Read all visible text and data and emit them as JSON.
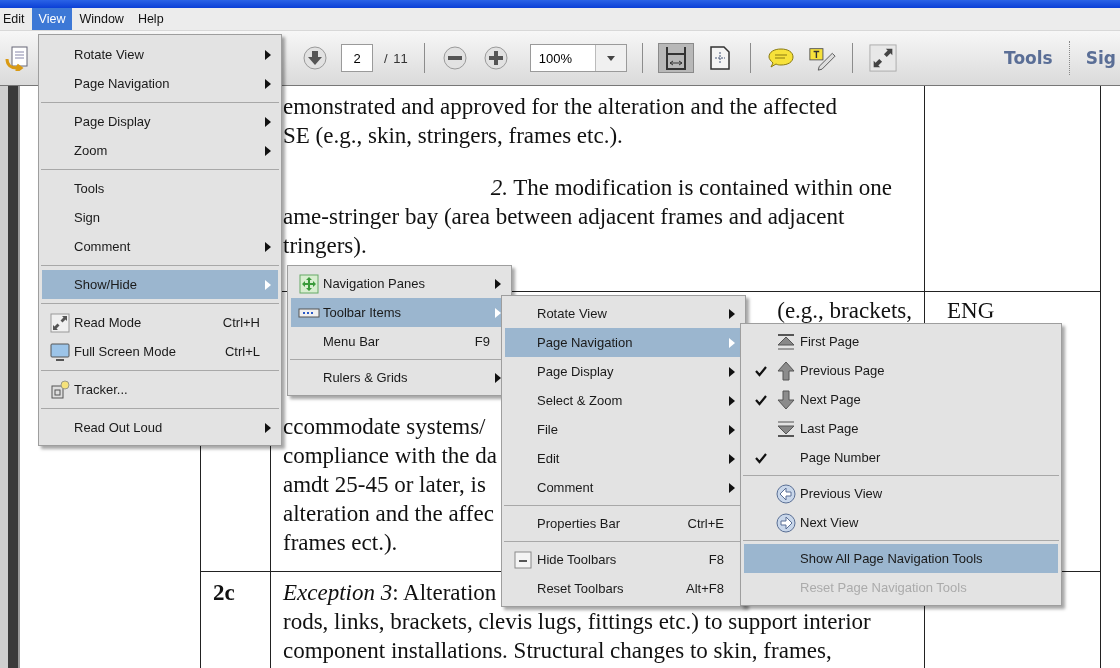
{
  "menubar": [
    {
      "label": "Edit",
      "selected": false
    },
    {
      "label": "View",
      "selected": true
    },
    {
      "label": "Window",
      "selected": false
    },
    {
      "label": "Help",
      "selected": false
    }
  ],
  "toolbar": {
    "left": [
      {
        "kind": "icon-button",
        "pressed": false
      }
    ],
    "main": [
      {
        "kind": "icon-button",
        "pressed": false
      },
      {
        "kind": "page-field",
        "value": "2"
      },
      {
        "kind": "text",
        "text": "/ 11"
      },
      {
        "kind": "separator"
      },
      {
        "kind": "icon-button",
        "pressed": false
      },
      {
        "kind": "icon-button",
        "pressed": false
      },
      {
        "kind": "zoom-field",
        "value": "100%"
      },
      {
        "kind": "separator"
      },
      {
        "kind": "icon-button",
        "pressed": true
      },
      {
        "kind": "icon-button",
        "pressed": false
      },
      {
        "kind": "separator"
      },
      {
        "kind": "icon-button",
        "pressed": false
      },
      {
        "kind": "icon-button",
        "pressed": false
      },
      {
        "kind": "separator"
      },
      {
        "kind": "icon-button",
        "pressed": false
      }
    ],
    "right": [
      {
        "kind": "link",
        "text": "Tools"
      },
      {
        "kind": "separator"
      },
      {
        "kind": "link",
        "text": "Sig"
      }
    ]
  },
  "document": {
    "rows": [
      {
        "lines": [
          {
            "kind": "text",
            "text": "emonstrated and approved for the alteration and the affected"
          },
          {
            "kind": "text",
            "text": "SE (e.g., skin, stringers, frames etc.)."
          },
          {
            "kind": "numbered",
            "text": "*2.* The modification is contained within one"
          },
          {
            "kind": "text",
            "text": "ame-stringer bay (area between adjacent frames and adjacent"
          },
          {
            "kind": "text",
            "text": "tringers)."
          }
        ]
      },
      {
        "lead": "(e.g., brackets,",
        "category": "ENG",
        "lines": [
          {
            "kind": "text",
            "text": "ccommodate systems/"
          },
          {
            "kind": "text",
            "text": "compliance with the da"
          },
          {
            "kind": "text",
            "text": "amdt 25-45 or later, is"
          },
          {
            "kind": "text",
            "text": "alteration and the affec"
          },
          {
            "kind": "text",
            "text": "frames ect.)."
          }
        ]
      },
      {
        "number": "2c",
        "lines": [
          {
            "kind": "text",
            "text": "*Exception 3*: Alteration"
          },
          {
            "kind": "text",
            "text": "rods, links, brackets, clevis lugs, fittings etc.) to support interior"
          },
          {
            "kind": "text",
            "text": "component installations. Structural changes to skin, frames,"
          }
        ]
      }
    ]
  },
  "menus": [
    {
      "items": [
        {
          "kind": "item",
          "label": "Rotate View",
          "submenu": true,
          "selected": false
        },
        {
          "kind": "item",
          "label": "Page Navigation",
          "submenu": true,
          "selected": false
        },
        {
          "kind": "separator"
        },
        {
          "kind": "item",
          "label": "Page Display",
          "submenu": true,
          "selected": false
        },
        {
          "kind": "item",
          "label": "Zoom",
          "submenu": true,
          "selected": false
        },
        {
          "kind": "separator"
        },
        {
          "kind": "item",
          "label": "Tools",
          "submenu": false,
          "selected": false
        },
        {
          "kind": "item",
          "label": "Sign",
          "submenu": false,
          "selected": false
        },
        {
          "kind": "item",
          "label": "Comment",
          "submenu": true,
          "selected": false
        },
        {
          "kind": "separator"
        },
        {
          "kind": "item",
          "label": "Show/Hide",
          "submenu": true,
          "selected": true
        },
        {
          "kind": "separator"
        },
        {
          "kind": "item",
          "label": "Read Mode",
          "shortcut": "Ctrl+H",
          "submenu": false,
          "selected": false
        },
        {
          "kind": "item",
          "label": "Full Screen Mode",
          "shortcut": "Ctrl+L",
          "submenu": false,
          "selected": false
        },
        {
          "kind": "separator"
        },
        {
          "kind": "item",
          "label": "Tracker...",
          "submenu": false,
          "selected": false
        },
        {
          "kind": "separator"
        },
        {
          "kind": "item",
          "label": "Read Out Loud",
          "submenu": true,
          "selected": false
        }
      ]
    },
    {
      "items": [
        {
          "kind": "item",
          "label": "Navigation Panes",
          "submenu": true,
          "selected": false
        },
        {
          "kind": "item",
          "label": "Toolbar Items",
          "submenu": true,
          "selected": true
        },
        {
          "kind": "item",
          "label": "Menu Bar",
          "shortcut": "F9",
          "submenu": false,
          "selected": false
        },
        {
          "kind": "separator"
        },
        {
          "kind": "item",
          "label": "Rulers & Grids",
          "submenu": true,
          "selected": false
        }
      ]
    },
    {
      "items": [
        {
          "kind": "item",
          "label": "Rotate View",
          "submenu": true,
          "selected": false
        },
        {
          "kind": "item",
          "label": "Page Navigation",
          "submenu": true,
          "selected": true
        },
        {
          "kind": "item",
          "label": "Page Display",
          "submenu": true,
          "selected": false
        },
        {
          "kind": "item",
          "label": "Select & Zoom",
          "submenu": true,
          "selected": false
        },
        {
          "kind": "item",
          "label": "File",
          "submenu": true,
          "selected": false
        },
        {
          "kind": "item",
          "label": "Edit",
          "submenu": true,
          "selected": false
        },
        {
          "kind": "item",
          "label": "Comment",
          "submenu": true,
          "selected": false
        },
        {
          "kind": "separator"
        },
        {
          "kind": "item",
          "label": "Properties Bar",
          "shortcut": "Ctrl+E",
          "submenu": false,
          "selected": false
        },
        {
          "kind": "separator"
        },
        {
          "kind": "item",
          "label": "Hide Toolbars",
          "shortcut": "F8",
          "submenu": false,
          "selected": false
        },
        {
          "kind": "item",
          "label": "Reset Toolbars",
          "shortcut": "Alt+F8",
          "submenu": false,
          "selected": false
        }
      ]
    },
    {
      "items": [
        {
          "kind": "item",
          "label": "First Page",
          "checked": false,
          "disabled": false,
          "selected": false
        },
        {
          "kind": "item",
          "label": "Previous Page",
          "checked": true,
          "disabled": false,
          "selected": false
        },
        {
          "kind": "item",
          "label": "Next Page",
          "checked": true,
          "disabled": false,
          "selected": false
        },
        {
          "kind": "item",
          "label": "Last Page",
          "checked": false,
          "disabled": false,
          "selected": false
        },
        {
          "kind": "item",
          "label": "Page Number",
          "checked": true,
          "disabled": false,
          "selected": false
        },
        {
          "kind": "separator"
        },
        {
          "kind": "item",
          "label": "Previous View",
          "checked": false,
          "disabled": false,
          "selected": false
        },
        {
          "kind": "item",
          "label": "Next View",
          "checked": false,
          "disabled": false,
          "selected": false
        },
        {
          "kind": "separator"
        },
        {
          "kind": "item",
          "label": "Show All Page Navigation Tools",
          "checked": false,
          "disabled": false,
          "selected": true
        },
        {
          "kind": "item",
          "label": "Reset Page Navigation Tools",
          "checked": false,
          "disabled": true,
          "selected": false
        }
      ]
    }
  ]
}
